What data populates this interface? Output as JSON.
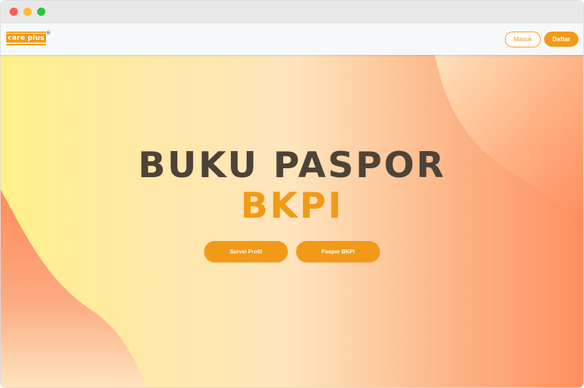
{
  "window": {
    "controls": [
      "close",
      "minimize",
      "maximize"
    ],
    "colors": {
      "close": "#fe5f57",
      "minimize": "#febc2e",
      "maximize": "#28c840"
    }
  },
  "navbar": {
    "logo": {
      "text": "care plus",
      "mark": "®"
    },
    "login_label": "Masuk",
    "register_label": "Daftar"
  },
  "hero": {
    "title": "BUKU PASPOR",
    "subtitle": "BKPI",
    "buttons": [
      {
        "label": "Survei Profil"
      },
      {
        "label": "Paspor BKPI"
      }
    ]
  },
  "colors": {
    "accent": "#f29a17",
    "title_text": "#4d4338",
    "gradient_start": "#fff08a",
    "gradient_end": "#ff8f5f"
  }
}
